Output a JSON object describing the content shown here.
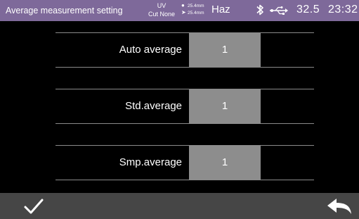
{
  "status_bar": {
    "title": "Average measurement setting",
    "uv_line1": "UV",
    "uv_line2": "Cut None",
    "thickness_line1": "25.4mm",
    "thickness_line2": "25.4mm",
    "mode": "Haz",
    "temperature": "32.5",
    "time": "23:32",
    "icons": [
      "bluetooth-icon",
      "usb-icon"
    ]
  },
  "settings": [
    {
      "label": "Auto average",
      "value": "1"
    },
    {
      "label": "Std.average",
      "value": "1"
    },
    {
      "label": "Smp.average",
      "value": "1"
    }
  ],
  "bottom_bar": {
    "confirm_icon": "checkmark-icon",
    "back_icon": "back-arrow-icon"
  }
}
